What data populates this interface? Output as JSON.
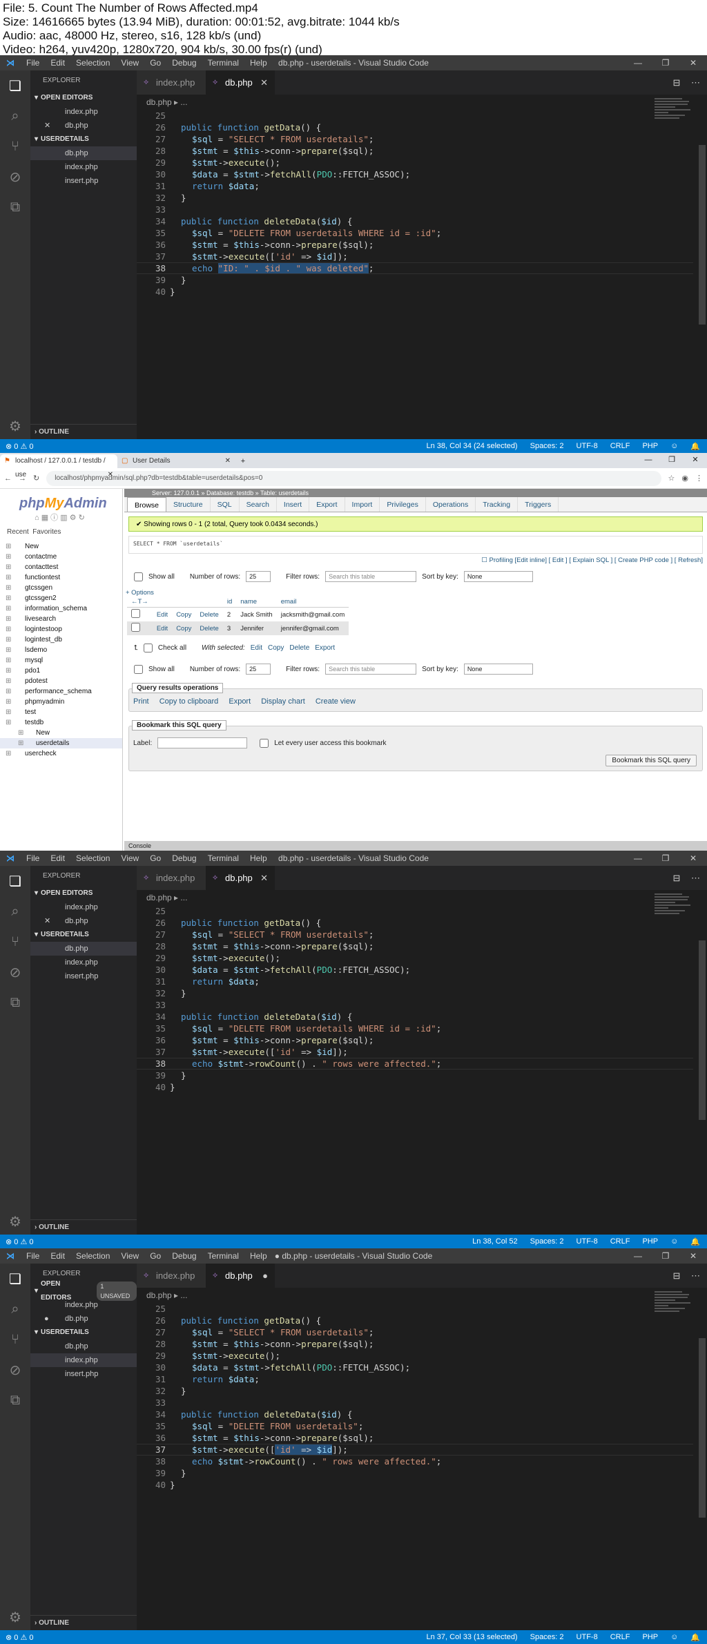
{
  "header": {
    "file": "File: 5. Count The Number of Rows Affected.mp4",
    "size": "Size: 14616665 bytes (13.94 MiB), duration: 00:01:52, avg.bitrate: 1044 kb/s",
    "audio": "Audio: aac, 48000 Hz, stereo, s16, 128 kb/s (und)",
    "video": "Video: h264, yuv420p, 1280x720, 904 kb/s, 30.00 fps(r) (und)"
  },
  "vscode": {
    "menu": [
      "File",
      "Edit",
      "Selection",
      "View",
      "Go",
      "Debug",
      "Terminal",
      "Help"
    ],
    "title": "db.php - userdetails - Visual Studio Code",
    "title_unsaved": "● db.php - userdetails - Visual Studio Code",
    "explorer": "EXPLORER",
    "open_editors": "OPEN EDITORS",
    "unsaved_badge": "1 UNSAVED",
    "folder": "USERDETAILS",
    "open_files": [
      "index.php",
      "db.php"
    ],
    "folder_files": [
      "db.php",
      "index.php",
      "insert.php"
    ],
    "outline": "OUTLINE",
    "tabs": [
      "index.php",
      "db.php"
    ],
    "crumb": "db.php ▸ ...",
    "close": "✕",
    "dot": "●",
    "line_nums": [
      "25",
      "26",
      "27",
      "28",
      "29",
      "30",
      "31",
      "32",
      "33",
      "34",
      "35",
      "36",
      "37",
      "38",
      "39",
      "40"
    ],
    "status_left": "⊗ 0 ⚠ 0",
    "status_common": [
      "Spaces: 2",
      "UTF-8",
      "CRLF",
      "PHP",
      "☺",
      "🔔"
    ],
    "status1_pos": "Ln 38, Col 34 (24 selected)",
    "status2_pos": "Ln 38, Col 52",
    "status3_pos": "Ln 37, Col 33 (13 selected)"
  },
  "code": {
    "l26a": "public function ",
    "l26b": "getData",
    "l26c": "() {",
    "l27a": "$sql",
    "l27b": " = ",
    "l27c": "\"SELECT * FROM userdetails\"",
    "l27d": ";",
    "l28a": "$stmt",
    "l28b": " = ",
    "l28c": "$this",
    "l28d": "->conn->",
    "l28e": "prepare",
    "l28f": "($sql);",
    "l29a": "$stmt",
    "l29b": "->",
    "l29c": "execute",
    "l29d": "();",
    "l30a": "$data",
    "l30b": " = ",
    "l30c": "$stmt",
    "l30d": "->",
    "l30e": "fetchAll",
    "l30f": "(",
    "l30g": "PDO",
    "l30h": "::FETCH_ASSOC);",
    "l31a": "return ",
    "l31b": "$data",
    "l31c": ";",
    "l32": "}",
    "l34a": "public function ",
    "l34b": "deleteData",
    "l34c": "(",
    "l34d": "$id",
    "l34e": ") {",
    "l35a1": "\"DELETE FROM userdetails WHERE id = :id\"",
    "l35a3": "\"DELETE FROM userdetails\"",
    "l37a": "$stmt",
    "l37b": "->",
    "l37c": "execute",
    "l37d": "([",
    "l37e": "'id'",
    "l37f": " => ",
    "l37g": "$id",
    "l37h": "]);",
    "l38_1a": "echo ",
    "l38_1b": "\"ID: \" . $id . \" was deleted\"",
    "l38_1c": ";",
    "l38_2a": "echo ",
    "l38_2b": "$stmt",
    "l38_2c": "->",
    "l38_2d": "rowCount",
    "l38_2e": "() . ",
    "l38_2f": "\" rows were affected.\"",
    "l38_2g": ";",
    "l39": "}",
    "l40": "}"
  },
  "browser": {
    "tab1": "localhost / 127.0.0.1 / testdb / use",
    "tab2": "User Details",
    "url": "localhost/phpmyadmin/sql.php?db=testdb&table=userdetails&pos=0",
    "logo1": "php",
    "logo2": "My",
    "logo3": "Admin",
    "recent": "Recent",
    "favorites": "Favorites",
    "databases": [
      "New",
      "contactme",
      "contacttest",
      "functiontest",
      "gtcssgen",
      "gtcssgen2",
      "information_schema",
      "livesearch",
      "logintestoop",
      "logintest_db",
      "lsdemo",
      "mysql",
      "pdo1",
      "pdotest",
      "performance_schema",
      "phpmyadmin",
      "test",
      "testdb"
    ],
    "sub_new": "New",
    "sub_table": "userdetails",
    "after": "usercheck",
    "server": "Server: 127.0.0.1 » Database: testdb » Table: userdetails",
    "tabs": [
      "Browse",
      "Structure",
      "SQL",
      "Search",
      "Insert",
      "Export",
      "Import",
      "Privileges",
      "Operations",
      "Tracking",
      "Triggers"
    ],
    "ok": "✔ Showing rows 0 - 1 (2 total, Query took 0.0434 seconds.)",
    "sql": "SELECT * FROM `userdetails`",
    "profiling": "☐ Profiling [Edit inline] [ Edit ] [ Explain SQL ] [ Create PHP code ] [ Refresh]",
    "show_all": "Show all",
    "num_rows": "Number of rows:",
    "num_val": "25",
    "filter": "Filter rows:",
    "filter_ph": "Search this table",
    "sort": "Sort by key:",
    "sort_val": "None",
    "options": "+ Options",
    "cols": [
      "id",
      "name",
      "email"
    ],
    "rows": [
      {
        "id": "2",
        "name": "Jack Smith",
        "email": "jacksmith@gmail.com"
      },
      {
        "id": "3",
        "name": "Jennifer",
        "email": "jennifer@gmail.com"
      }
    ],
    "edit": "Edit",
    "copy": "Copy",
    "delete": "Delete",
    "check_all": "Check all",
    "with_selected": "With selected:",
    "export": "Export",
    "qro": "Query results operations",
    "ops": [
      "Print",
      "Copy to clipboard",
      "Export",
      "Display chart",
      "Create view"
    ],
    "bookmark": "Bookmark this SQL query",
    "label": "Label:",
    "let_every": "Let every user access this bookmark",
    "bookmark_btn": "Bookmark this SQL query",
    "console": "Console"
  }
}
